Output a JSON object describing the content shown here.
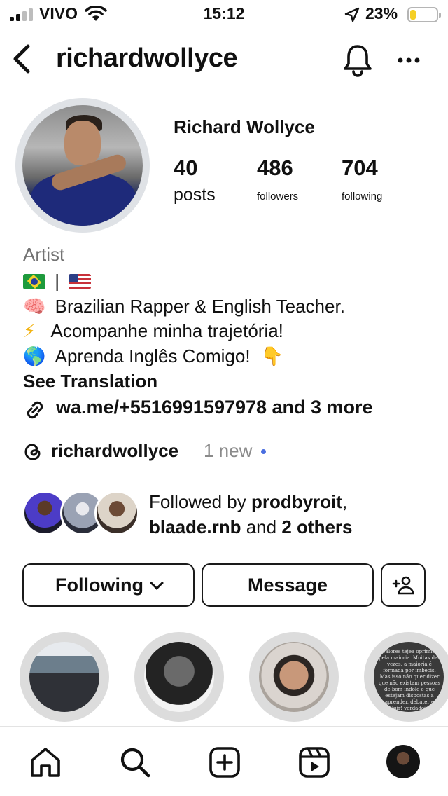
{
  "status_bar": {
    "carrier": "VIVO",
    "time": "15:12",
    "battery_percent": "23%",
    "battery_level": 0.23,
    "battery_color": "#f5cf25",
    "icons": [
      "signal-icon",
      "wifi-icon",
      "location-arrow-icon",
      "battery-icon"
    ]
  },
  "header": {
    "username": "richardwollyce",
    "icons": [
      "back-chevron-icon",
      "bell-icon",
      "more-dots-icon"
    ]
  },
  "profile": {
    "full_name": "Richard Wollyce",
    "stats": [
      {
        "value": "40",
        "label": "posts"
      },
      {
        "value": "486",
        "label": "followers"
      },
      {
        "value": "704",
        "label": "following"
      }
    ]
  },
  "bio": {
    "category": "Artist",
    "flags_separator": "|",
    "lines": [
      {
        "emoji": "🧠",
        "text": "Brazilian Rapper & English Teacher."
      },
      {
        "emoji": "⚡",
        "text": "Acompanhe minha trajetória!"
      },
      {
        "emoji": "🌎",
        "text": "Aprenda Inglês Comigo!",
        "trailing_emoji": "👇"
      }
    ],
    "see_translation": "See Translation",
    "link": "wa.me/+5516991597978 and 3 more"
  },
  "threads": {
    "username": "richardwollyce",
    "badge": "1 new",
    "dot_color": "#4a6ee0"
  },
  "followed_by": {
    "prefix": "Followed by",
    "user1": "prodbyroit",
    "separator": ",",
    "user2": "blaade.rnb",
    "middle": "and",
    "others": "2 others"
  },
  "actions": {
    "following": "Following",
    "message": "Message"
  },
  "highlights": {
    "count_visible": 4,
    "quote_snippet": "2 valores tejea oprimidos pela maioria. Muitas das vezes, a maioria é formada por imbecis. Mas isso não quer dizer que não existam pessoas de bom índole e que estejam dispostas a aprender, debater e evoluir! verdadeira..."
  },
  "tab_bar": {
    "tabs": [
      "home",
      "search",
      "create",
      "reels",
      "profile"
    ]
  }
}
